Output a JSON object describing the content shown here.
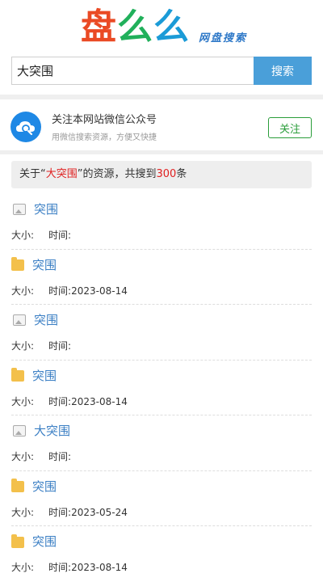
{
  "logo": {
    "chars": [
      "盘",
      "么",
      "么"
    ],
    "subtitle": "网盘搜索"
  },
  "search": {
    "value": "大突围",
    "button": "搜索"
  },
  "follow": {
    "title": "关注本网站微信公众号",
    "subtitle": "用微信搜索资源，方便又快捷",
    "button": "关注"
  },
  "summary": {
    "prefix": "关于“",
    "keyword": "大突围",
    "middle": "”的资源，共搜到",
    "count": "300",
    "suffix": "条"
  },
  "results": [
    {
      "type": "image",
      "title": "突围",
      "size_label": "大小:",
      "time_label": "时间:",
      "time": ""
    },
    {
      "type": "folder",
      "title": "突围",
      "size_label": "大小:",
      "time_label": "时间:",
      "time": "2023-08-14"
    },
    {
      "type": "image",
      "title": "突围",
      "size_label": "大小:",
      "time_label": "时间:",
      "time": ""
    },
    {
      "type": "folder",
      "title": "突围",
      "size_label": "大小:",
      "time_label": "时间:",
      "time": "2023-08-14"
    },
    {
      "type": "image",
      "title": "大突围",
      "size_label": "大小:",
      "time_label": "时间:",
      "time": ""
    },
    {
      "type": "folder",
      "title": "突围",
      "size_label": "大小:",
      "time_label": "时间:",
      "time": "2023-05-24"
    },
    {
      "type": "folder",
      "title": "突围",
      "size_label": "大小:",
      "time_label": "时间:",
      "time": "2023-08-14"
    }
  ]
}
